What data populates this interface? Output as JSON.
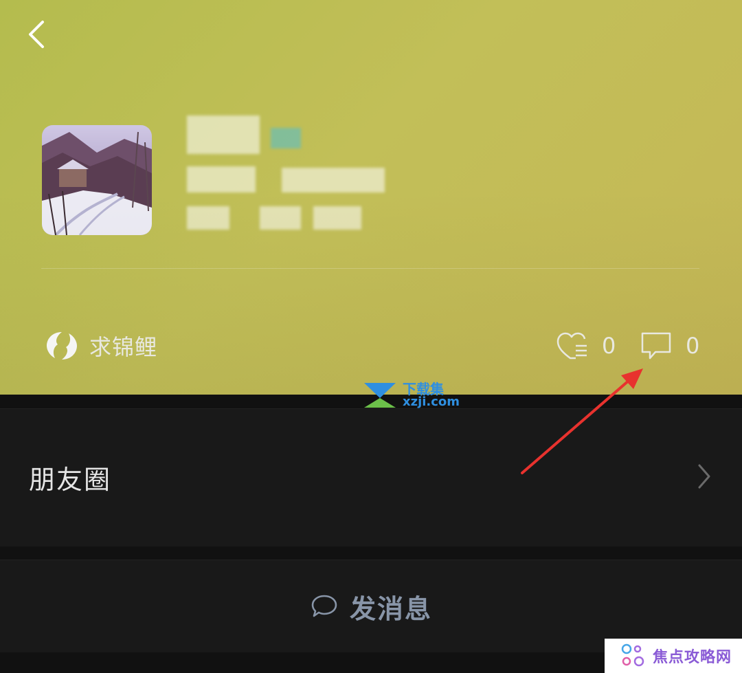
{
  "header": {
    "back_icon": "chevron-left-icon"
  },
  "profile": {
    "avatar_description": "snowy-village-painting",
    "name_hidden": true
  },
  "status": {
    "icon": "koi-fish-icon",
    "label": "求锦鲤"
  },
  "stats": {
    "likes": {
      "icon": "heart-list-icon",
      "count": "0"
    },
    "comments": {
      "icon": "comment-bubble-icon",
      "count": "0"
    }
  },
  "rows": {
    "moments": {
      "label": "朋友圈",
      "icon": "chevron-right-icon"
    },
    "message": {
      "label": "发消息",
      "icon": "chat-bubble-icon"
    }
  },
  "watermark": {
    "cn": "下载集",
    "en": "xzji.com"
  },
  "corner_watermark": {
    "text": "焦点攻略网"
  },
  "colors": {
    "hero_start": "#b4bc4e",
    "hero_end": "#c5b756",
    "dark_row": "#191919",
    "message_text": "#8895a8",
    "arrow_red": "#e8322e"
  }
}
